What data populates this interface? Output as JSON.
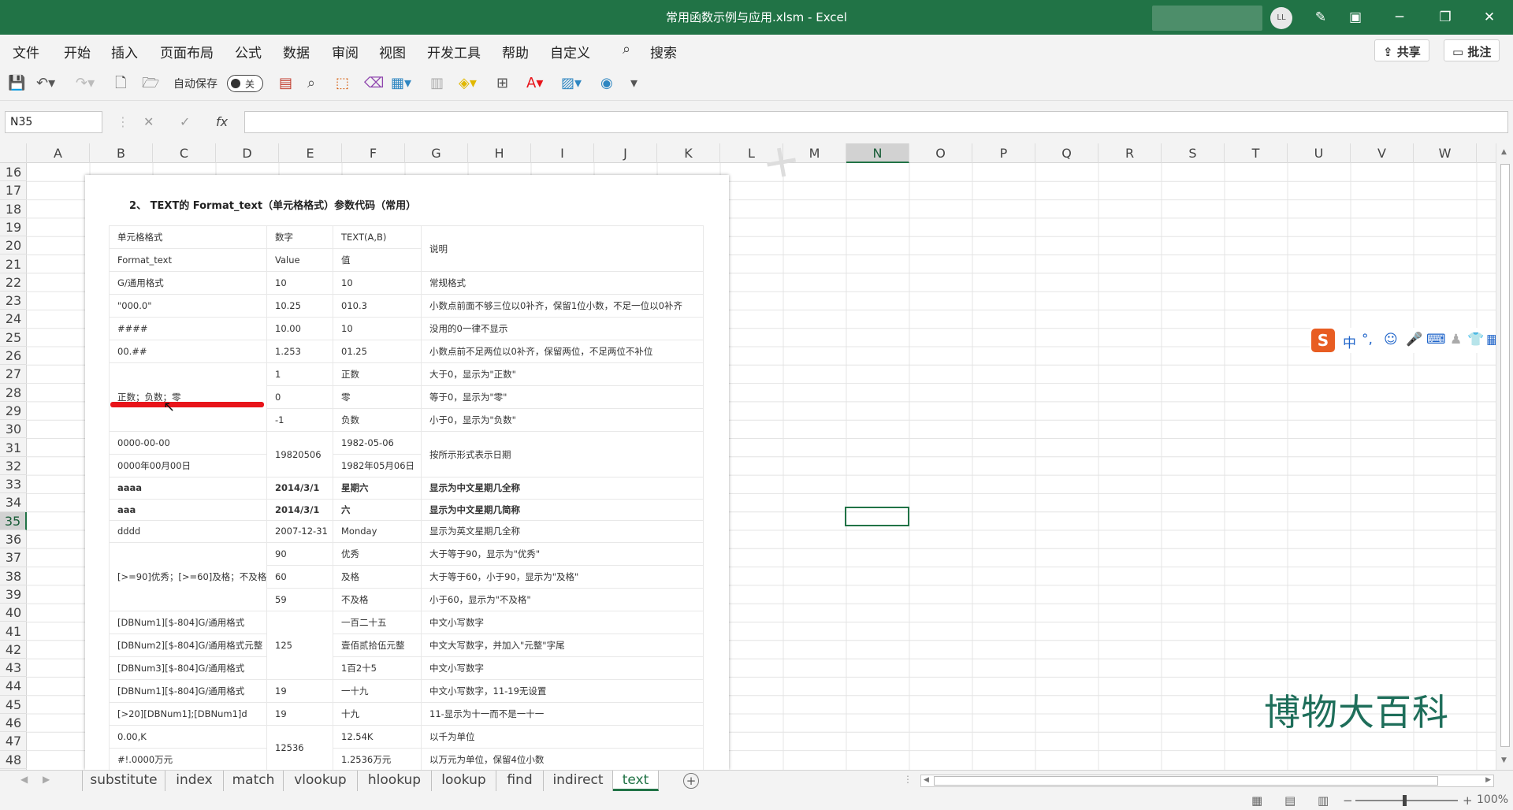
{
  "window": {
    "title": "常用函数示例与应用.xlsm  -  Excel",
    "user_initials": "LL",
    "min": "─",
    "restore": "❐",
    "close": "✕"
  },
  "menu": [
    "文件",
    "开始",
    "插入",
    "页面布局",
    "公式",
    "数据",
    "审阅",
    "视图",
    "开发工具",
    "帮助",
    "自定义"
  ],
  "search_label": "搜索",
  "share_label": "共享",
  "comment_label": "批注",
  "quick_access": {
    "autosave_label": "自动保存",
    "autosave_state": "关"
  },
  "formula_bar": {
    "name_box": "N35",
    "cancel": "✕",
    "enter": "✓",
    "fx": "fx",
    "value": ""
  },
  "columns": [
    "A",
    "B",
    "C",
    "D",
    "E",
    "F",
    "G",
    "H",
    "I",
    "J",
    "K",
    "L",
    "M",
    "N",
    "O",
    "P",
    "Q",
    "R",
    "S",
    "T",
    "U",
    "V",
    "W"
  ],
  "selected_column": "N",
  "rows": [
    "16",
    "17",
    "18",
    "19",
    "20",
    "21",
    "22",
    "23",
    "24",
    "25",
    "26",
    "27",
    "28",
    "29",
    "30",
    "31",
    "32",
    "33",
    "34",
    "35",
    "36",
    "37",
    "38",
    "39",
    "40",
    "41",
    "42",
    "43",
    "44",
    "45",
    "46",
    "47",
    "48"
  ],
  "selected_row": "35",
  "embedded_sheet": {
    "title": "2、 TEXT的 Format_text（单元格格式）参数代码（常用）",
    "table": [
      [
        "单元格格式",
        "数字",
        "TEXT(A,B)",
        "说明"
      ],
      [
        "Format_text",
        "Value",
        "值",
        ""
      ],
      [
        "G/通用格式",
        "10",
        "10",
        "常规格式"
      ],
      [
        "\"000.0\"",
        "10.25",
        "010.3",
        "小数点前面不够三位以0补齐，保留1位小数，不足一位以0补齐"
      ],
      [
        "####",
        "10.00",
        "10",
        "没用的0一律不显示"
      ],
      [
        "00.##",
        "1.253",
        "01.25",
        "小数点前不足两位以0补齐，保留两位，不足两位不补位"
      ],
      [
        "",
        "1",
        "正数",
        "大于0，显示为\"正数\""
      ],
      [
        "正数；负数；零",
        "0",
        "零",
        "等于0，显示为\"零\""
      ],
      [
        "",
        "-1",
        "负数",
        "小于0，显示为\"负数\""
      ],
      [
        "0000-00-00",
        "19820506",
        "1982-05-06",
        "按所示形式表示日期"
      ],
      [
        "0000年00月00日",
        "",
        "1982年05月06日",
        ""
      ],
      [
        "aaaa",
        "2014/3/1",
        "星期六",
        "显示为中文星期几全称"
      ],
      [
        "aaa",
        "2014/3/1",
        "六",
        "显示为中文星期几简称"
      ],
      [
        "dddd",
        "2007-12-31",
        "Monday",
        "显示为英文星期几全称"
      ],
      [
        "",
        "90",
        "优秀",
        "大于等于90，显示为\"优秀\""
      ],
      [
        "[>=90]优秀；[>=60]及格；不及格",
        "60",
        "及格",
        "大于等于60，小于90，显示为\"及格\""
      ],
      [
        "",
        "59",
        "不及格",
        "小于60，显示为\"不及格\""
      ],
      [
        "[DBNum1][$-804]G/通用格式",
        "",
        "一百二十五",
        "中文小写数字"
      ],
      [
        "[DBNum2][$-804]G/通用格式元整",
        "125",
        "壹佰贰拾伍元整",
        "中文大写数字，并加入\"元整\"字尾"
      ],
      [
        "[DBNum3][$-804]G/通用格式",
        "",
        "1百2十5",
        "中文小写数字"
      ],
      [
        "[DBNum1][$-804]G/通用格式",
        "19",
        "一十九",
        "中文小写数字，11-19无设置"
      ],
      [
        "[>20][DBNum1];[DBNum1]d",
        "19",
        "十九",
        "11-显示为十一而不是一十一"
      ],
      [
        "0.00,K",
        "",
        "12.54K",
        "以千为单位"
      ],
      [
        "#!.0000万元",
        "12536",
        "1.2536万元",
        "以万元为单位，保留4位小数"
      ]
    ]
  },
  "ime": {
    "lang": "中",
    "punct": "°,",
    "emoji": "☺",
    "voice": "🎤",
    "keyboard": "⌨",
    "skin": "👕",
    "grid": "▦"
  },
  "brand_watermark": "博物大百科",
  "sheet_tabs": [
    "substitute",
    "index",
    "match",
    "vlookup",
    "hlookup",
    "lookup",
    "find",
    "indirect",
    "text"
  ],
  "active_tab": "text",
  "status": {
    "zoom": "100%",
    "minus": "−",
    "plus": "+"
  }
}
